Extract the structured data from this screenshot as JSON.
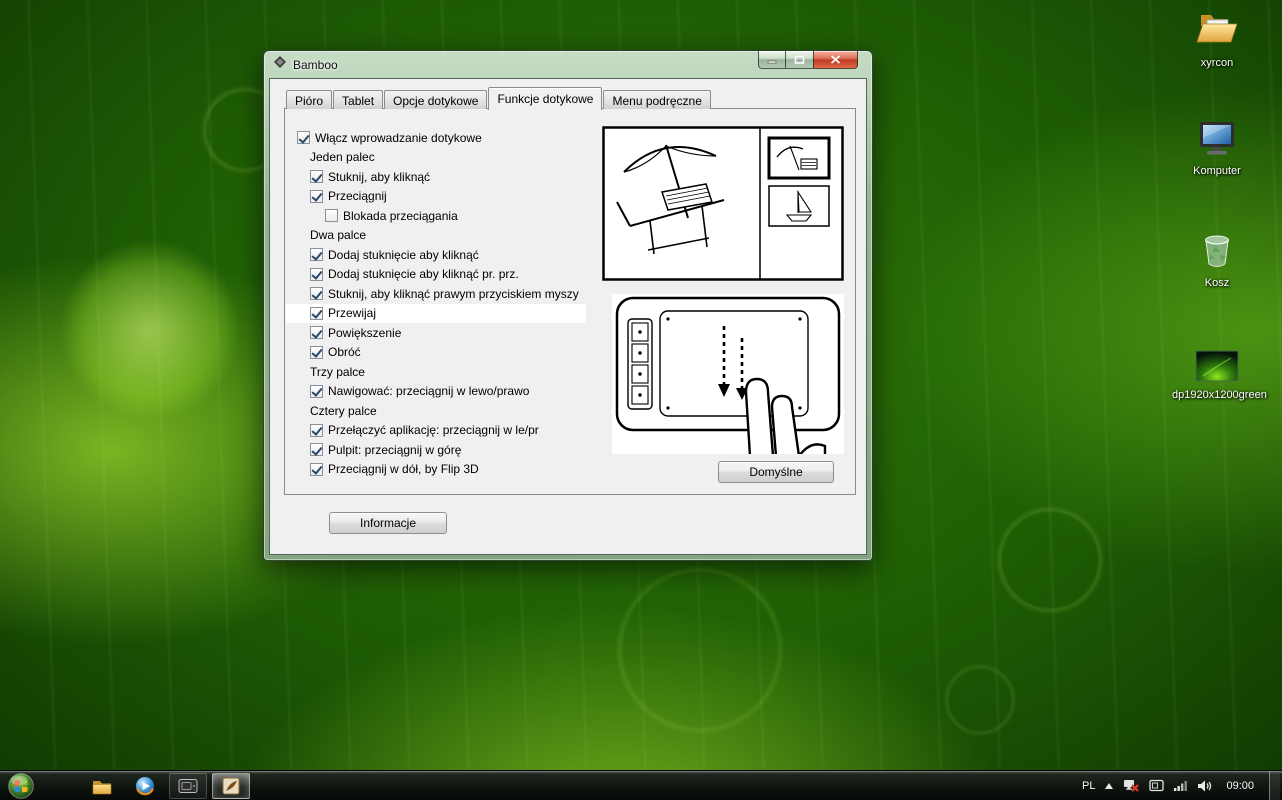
{
  "window": {
    "title": "Bamboo",
    "tabs": [
      {
        "label": "Pióro",
        "active": false
      },
      {
        "label": "Tablet",
        "active": false
      },
      {
        "label": "Opcje dotykowe",
        "active": false
      },
      {
        "label": "Funkcje dotykowe",
        "active": true
      },
      {
        "label": "Menu podręczne",
        "active": false
      }
    ],
    "rows": [
      {
        "type": "check",
        "label": "Włącz wprowadzanie dotykowe",
        "checked": true,
        "indent": 0
      },
      {
        "type": "group",
        "label": "Jeden palec",
        "indent": 1
      },
      {
        "type": "check",
        "label": "Stuknij, aby kliknąć",
        "checked": true,
        "indent": 1
      },
      {
        "type": "check",
        "label": "Przeciągnij",
        "checked": true,
        "indent": 1
      },
      {
        "type": "check",
        "label": "Blokada przeciągania",
        "checked": false,
        "indent": 2
      },
      {
        "type": "group",
        "label": "Dwa palce",
        "indent": 1
      },
      {
        "type": "check",
        "label": "Dodaj stuknięcie aby kliknąć",
        "checked": true,
        "indent": 1
      },
      {
        "type": "check",
        "label": "Dodaj stuknięcie aby kliknąć pr. prz.",
        "checked": true,
        "indent": 1
      },
      {
        "type": "check",
        "label": "Stuknij, aby kliknąć prawym przyciskiem myszy",
        "checked": true,
        "indent": 1
      },
      {
        "type": "check",
        "label": "Przewijaj",
        "checked": true,
        "indent": 1,
        "highlighted": true
      },
      {
        "type": "check",
        "label": "Powiększenie",
        "checked": true,
        "indent": 1
      },
      {
        "type": "check",
        "label": "Obróć",
        "checked": true,
        "indent": 1
      },
      {
        "type": "group",
        "label": "Trzy palce",
        "indent": 1
      },
      {
        "type": "check",
        "label": "Nawigować: przeciągnij w lewo/prawo",
        "checked": true,
        "indent": 1
      },
      {
        "type": "group",
        "label": "Cztery palce",
        "indent": 1
      },
      {
        "type": "check",
        "label": "Przełączyć aplikację: przeciągnij w le/pr",
        "checked": true,
        "indent": 1
      },
      {
        "type": "check",
        "label": "Pulpit: przeciągnij w górę",
        "checked": true,
        "indent": 1
      },
      {
        "type": "check",
        "label": "Przeciągnij w dół, by Flip 3D",
        "checked": true,
        "indent": 1
      }
    ],
    "buttons": {
      "defaults": "Domyślne",
      "info": "Informacje"
    }
  },
  "desktop": {
    "icons": [
      {
        "label": "xyrcon",
        "type": "folder"
      },
      {
        "label": "Komputer",
        "type": "computer"
      },
      {
        "label": "Kosz",
        "type": "recycle-bin"
      },
      {
        "label": "dp1920x1200green",
        "type": "image-file"
      }
    ]
  },
  "taskbar": {
    "language": "PL",
    "clock": "09:00",
    "icons": [
      "start",
      "explorer",
      "media-player",
      "tablet-app",
      "bamboo-active"
    ],
    "tray_icons": [
      "expand",
      "network-error",
      "tablet-tray",
      "signal",
      "volume"
    ]
  },
  "colors": {
    "highlight_row": "#ffffff",
    "close_button": "#c23b26",
    "wallpaper_accent": "#7ed321",
    "dialog_bg": "#f0f0f0"
  }
}
